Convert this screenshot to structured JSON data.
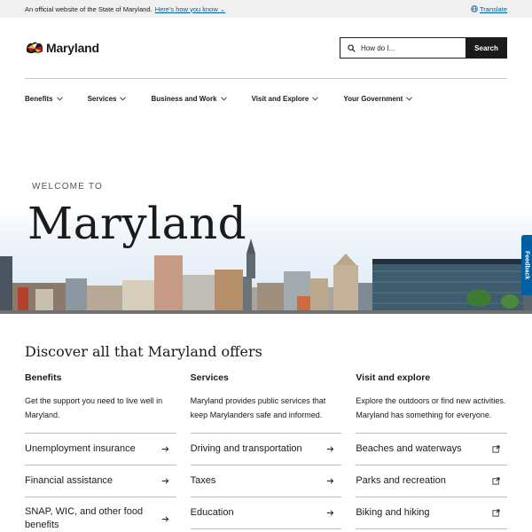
{
  "topbar": {
    "official_text": "An official website of the State of Maryland.",
    "how_link": "Here's how you know",
    "translate": "Translate"
  },
  "header": {
    "logo_text": "Maryland",
    "search_placeholder": "How do I...",
    "search_button": "Search"
  },
  "nav": {
    "items": [
      "Benefits",
      "Services",
      "Business and Work",
      "Visit and Explore",
      "Your Government"
    ]
  },
  "hero": {
    "eyebrow": "WELCOME TO",
    "title": "Maryland",
    "feedback": "Feedback"
  },
  "discover": {
    "heading": "Discover all that Maryland offers",
    "columns": [
      {
        "title": "Benefits",
        "description": "Get the support you need to live well in Maryland.",
        "links": [
          "Unemployment insurance",
          "Financial assistance",
          "SNAP, WIC, and other food benefits"
        ]
      },
      {
        "title": "Services",
        "description": "Maryland provides public services that keep Marylanders safe and informed.",
        "links": [
          "Driving and transportation",
          "Taxes",
          "Education"
        ]
      },
      {
        "title": "Visit and explore",
        "description": "Explore the outdoors or find new activities. Maryland has something for everyone.",
        "links": [
          "Beaches and waterways",
          "Parks and recreation",
          "Biking and hiking"
        ]
      }
    ]
  },
  "colors": {
    "link": "#005ea2",
    "dark": "#1b1b1b",
    "topbar_bg": "#f0f0f0"
  }
}
